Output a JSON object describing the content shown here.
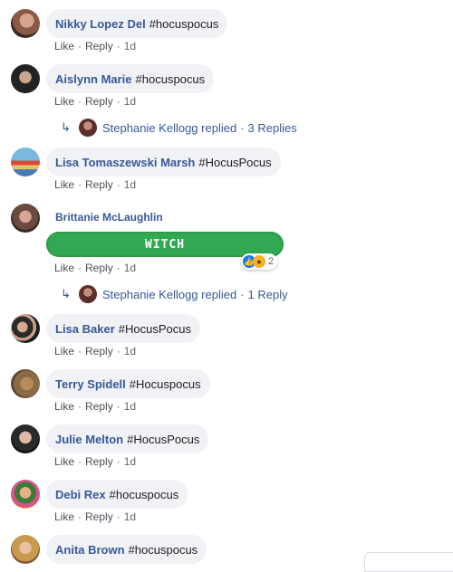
{
  "action_labels": {
    "like": "Like",
    "reply": "Reply",
    "dot": "·"
  },
  "comments": [
    {
      "name": "Nikky Lopez Del",
      "text": "#hocuspocus",
      "time": "1d"
    },
    {
      "name": "Aislynn Marie",
      "text": "#hocuspocus",
      "time": "1d",
      "replies": {
        "author": "Stephanie Kellogg",
        "verb": "replied",
        "count": "3 Replies"
      }
    },
    {
      "name": "Lisa Tomaszewski Marsh",
      "text": "#HocusPocus",
      "time": "1d"
    },
    {
      "name": "Brittanie McLaughlin",
      "sticker": "WITCH",
      "time": "1d",
      "reactions": {
        "types": [
          "like-icon",
          "wow-icon"
        ],
        "count": "2"
      },
      "replies": {
        "author": "Stephanie Kellogg",
        "verb": "replied",
        "count": "1 Reply"
      }
    },
    {
      "name": "Lisa Baker",
      "text": "#HocusPocus",
      "time": "1d"
    },
    {
      "name": "Terry Spidell",
      "text": "#Hocuspocus",
      "time": "1d"
    },
    {
      "name": "Julie Melton",
      "text": "#HocusPocus",
      "time": "1d"
    },
    {
      "name": "Debi Rex",
      "text": "#hocuspocus",
      "time": "1d"
    },
    {
      "name": "Anita Brown",
      "text": "#hocuspocus"
    }
  ],
  "colors": {
    "link": "#385898",
    "bubble": "#f0f2f5",
    "sticker": "#33a852",
    "like": "#1877f2",
    "wow": "#f7b125"
  }
}
